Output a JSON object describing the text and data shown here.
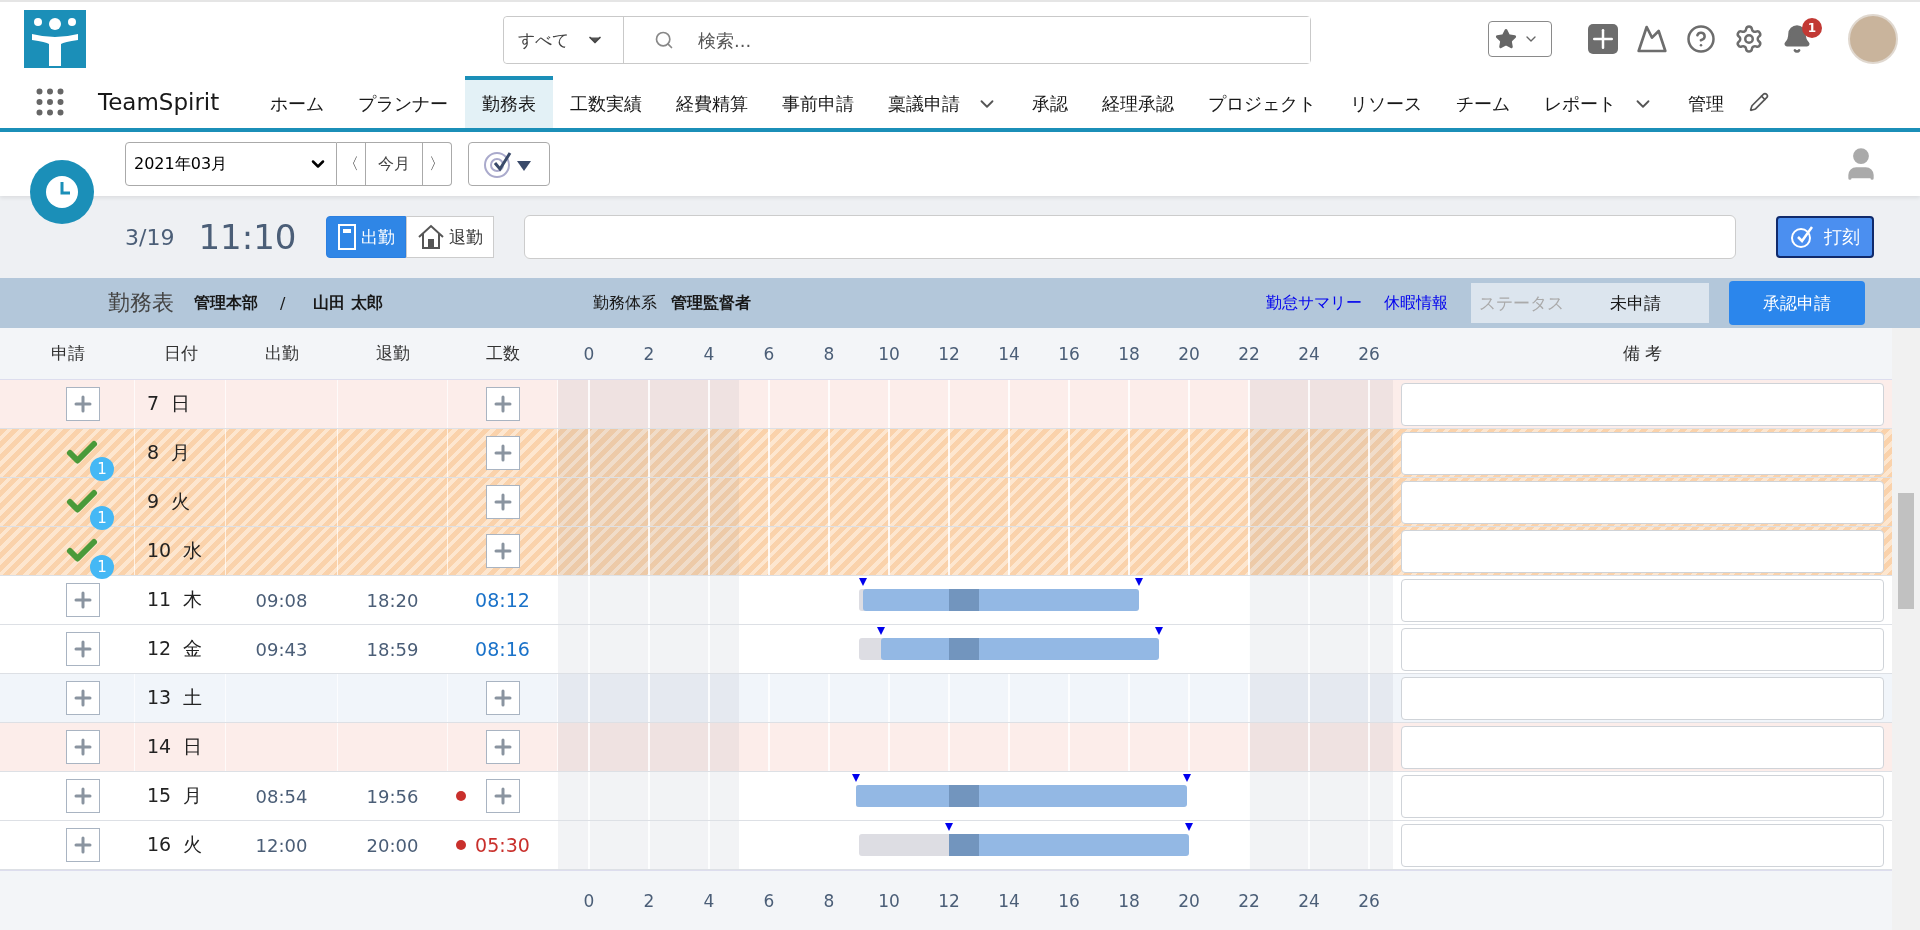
{
  "header": {
    "search_scope": "すべて",
    "search_placeholder": "検索...",
    "notification_count": "1"
  },
  "nav": {
    "app_name": "TeamSpirit",
    "tabs": [
      {
        "label": "ホーム",
        "selected": false,
        "menu": false
      },
      {
        "label": "プランナー",
        "selected": false,
        "menu": false
      },
      {
        "label": "勤務表",
        "selected": true,
        "menu": false
      },
      {
        "label": "工数実績",
        "selected": false,
        "menu": false
      },
      {
        "label": "経費精算",
        "selected": false,
        "menu": false
      },
      {
        "label": "事前申請",
        "selected": false,
        "menu": false
      },
      {
        "label": "稟議申請",
        "selected": false,
        "menu": true
      },
      {
        "label": "承認",
        "selected": false,
        "menu": false
      },
      {
        "label": "経理承認",
        "selected": false,
        "menu": false
      },
      {
        "label": "プロジェクト",
        "selected": false,
        "menu": false
      },
      {
        "label": "リソース",
        "selected": false,
        "menu": false
      },
      {
        "label": "チーム",
        "selected": false,
        "menu": false
      },
      {
        "label": "レポート",
        "selected": false,
        "menu": true
      },
      {
        "label": "管理",
        "selected": false,
        "menu": false
      }
    ]
  },
  "toolbar": {
    "month": "2021年03月",
    "prev": "〈",
    "today": "今月",
    "next": "〉"
  },
  "punch": {
    "date": "3/19",
    "time": "11:10",
    "buttons": [
      {
        "label": "出勤",
        "selected": true,
        "kind": "in"
      },
      {
        "label": "退勤",
        "selected": false,
        "kind": "out"
      }
    ],
    "stamp_button": "打刻"
  },
  "info": {
    "title": "勤務表",
    "department": "管理本部",
    "separator": "/",
    "employee": "山田 太郎",
    "system_label": "勤務体系",
    "system": "管理監督者",
    "links": [
      "勤怠サマリー",
      "休暇情報"
    ],
    "status_label": "ステータス",
    "status": "未申請",
    "submit_button": "承認申請"
  },
  "table": {
    "columns": [
      "申請",
      "日付",
      "出勤",
      "退勤",
      "工数"
    ],
    "remarks_column": "備 考",
    "header_ticks": [
      "0",
      "2",
      "4",
      "6",
      "8",
      "10",
      "12",
      "14",
      "16",
      "18",
      "20",
      "22",
      "24",
      "26"
    ],
    "footer_ticks": [
      "0",
      "2",
      "4",
      "6",
      "8",
      "10",
      "12",
      "14",
      "16",
      "18",
      "20",
      "22",
      "24",
      "26"
    ],
    "rows": [
      {
        "day": "7",
        "weekday": "日",
        "kind": "sunday",
        "applied": false
      },
      {
        "day": "8",
        "weekday": "月",
        "kind": "leave",
        "applied": true,
        "badge": "1"
      },
      {
        "day": "9",
        "weekday": "火",
        "kind": "leave",
        "applied": true,
        "badge": "1"
      },
      {
        "day": "10",
        "weekday": "水",
        "kind": "leave",
        "applied": true,
        "badge": "1"
      },
      {
        "day": "11",
        "weekday": "木",
        "kind": "weekday",
        "applied": false,
        "in": "09:08",
        "out": "18:20",
        "hours": "08:12",
        "warning": false
      },
      {
        "day": "12",
        "weekday": "金",
        "kind": "weekday",
        "applied": false,
        "in": "09:43",
        "out": "18:59",
        "hours": "08:16",
        "warning": false
      },
      {
        "day": "13",
        "weekday": "土",
        "kind": "saturday",
        "applied": false
      },
      {
        "day": "14",
        "weekday": "日",
        "kind": "sunday",
        "applied": false
      },
      {
        "day": "15",
        "weekday": "月",
        "kind": "weekday",
        "applied": false,
        "in": "08:54",
        "out": "19:56",
        "warning": true
      },
      {
        "day": "16",
        "weekday": "火",
        "kind": "weekday",
        "applied": false,
        "in": "12:00",
        "out": "20:00",
        "hours": "05:30",
        "warning": true
      }
    ]
  }
}
